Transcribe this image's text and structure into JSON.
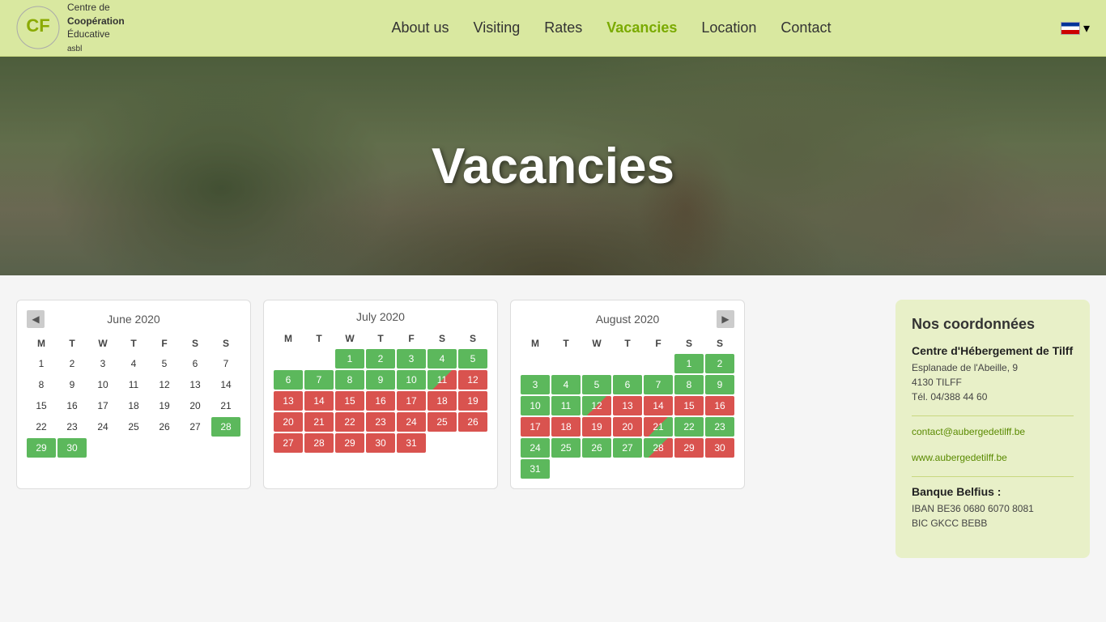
{
  "header": {
    "logo_line1": "Centre de",
    "logo_line2": "Coopération",
    "logo_line3": "Éducative",
    "logo_line4": "asbl",
    "nav": [
      {
        "label": "About us",
        "active": false
      },
      {
        "label": "Visiting",
        "active": false
      },
      {
        "label": "Rates",
        "active": false
      },
      {
        "label": "Vacancies",
        "active": true
      },
      {
        "label": "Location",
        "active": false
      },
      {
        "label": "Contact",
        "active": false
      }
    ]
  },
  "hero": {
    "title": "Vacancies"
  },
  "calendars": [
    {
      "month": "June 2020",
      "has_prev": true,
      "has_next": false,
      "days_of_week": [
        "M",
        "T",
        "W",
        "T",
        "F",
        "S",
        "S"
      ],
      "weeks": [
        [
          {
            "n": 1,
            "c": "white-bg"
          },
          {
            "n": 2,
            "c": "white-bg"
          },
          {
            "n": 3,
            "c": "white-bg"
          },
          {
            "n": 4,
            "c": "white-bg"
          },
          {
            "n": 5,
            "c": "white-bg"
          },
          {
            "n": 6,
            "c": "white-bg"
          },
          {
            "n": 7,
            "c": "white-bg"
          }
        ],
        [
          {
            "n": 8,
            "c": "white-bg"
          },
          {
            "n": 9,
            "c": "white-bg"
          },
          {
            "n": 10,
            "c": "white-bg"
          },
          {
            "n": 11,
            "c": "white-bg"
          },
          {
            "n": 12,
            "c": "white-bg"
          },
          {
            "n": 13,
            "c": "white-bg"
          },
          {
            "n": 14,
            "c": "white-bg"
          }
        ],
        [
          {
            "n": 15,
            "c": "white-bg"
          },
          {
            "n": 16,
            "c": "white-bg"
          },
          {
            "n": 17,
            "c": "white-bg"
          },
          {
            "n": 18,
            "c": "white-bg"
          },
          {
            "n": 19,
            "c": "white-bg"
          },
          {
            "n": 20,
            "c": "white-bg"
          },
          {
            "n": 21,
            "c": "white-bg"
          }
        ],
        [
          {
            "n": 22,
            "c": "white-bg"
          },
          {
            "n": 23,
            "c": "white-bg"
          },
          {
            "n": 24,
            "c": "white-bg"
          },
          {
            "n": 25,
            "c": "white-bg"
          },
          {
            "n": 26,
            "c": "white-bg"
          },
          {
            "n": 27,
            "c": "white-bg"
          },
          {
            "n": 28,
            "c": "green"
          }
        ],
        [
          {
            "n": 29,
            "c": "green"
          },
          {
            "n": 30,
            "c": "green"
          },
          {
            "n": 0,
            "c": "empty"
          },
          {
            "n": 0,
            "c": "empty"
          },
          {
            "n": 0,
            "c": "empty"
          },
          {
            "n": 0,
            "c": "empty"
          },
          {
            "n": 0,
            "c": "empty"
          }
        ]
      ]
    },
    {
      "month": "July 2020",
      "has_prev": false,
      "has_next": false,
      "days_of_week": [
        "M",
        "T",
        "W",
        "T",
        "F",
        "S",
        "S"
      ],
      "weeks": [
        [
          {
            "n": 0,
            "c": "empty"
          },
          {
            "n": 0,
            "c": "empty"
          },
          {
            "n": 1,
            "c": "green"
          },
          {
            "n": 2,
            "c": "green"
          },
          {
            "n": 3,
            "c": "green"
          },
          {
            "n": 4,
            "c": "green"
          },
          {
            "n": 5,
            "c": "green"
          }
        ],
        [
          {
            "n": 6,
            "c": "green"
          },
          {
            "n": 7,
            "c": "green"
          },
          {
            "n": 8,
            "c": "green"
          },
          {
            "n": 9,
            "c": "green"
          },
          {
            "n": 10,
            "c": "green"
          },
          {
            "n": 11,
            "c": "half-green-red"
          },
          {
            "n": 12,
            "c": "red"
          }
        ],
        [
          {
            "n": 13,
            "c": "red"
          },
          {
            "n": 14,
            "c": "red"
          },
          {
            "n": 15,
            "c": "red"
          },
          {
            "n": 16,
            "c": "red"
          },
          {
            "n": 17,
            "c": "red"
          },
          {
            "n": 18,
            "c": "red"
          },
          {
            "n": 19,
            "c": "red"
          }
        ],
        [
          {
            "n": 20,
            "c": "red"
          },
          {
            "n": 21,
            "c": "red"
          },
          {
            "n": 22,
            "c": "red"
          },
          {
            "n": 23,
            "c": "red"
          },
          {
            "n": 24,
            "c": "red"
          },
          {
            "n": 25,
            "c": "red"
          },
          {
            "n": 26,
            "c": "red"
          }
        ],
        [
          {
            "n": 27,
            "c": "red"
          },
          {
            "n": 28,
            "c": "red"
          },
          {
            "n": 29,
            "c": "red"
          },
          {
            "n": 30,
            "c": "red"
          },
          {
            "n": 31,
            "c": "red"
          },
          {
            "n": 0,
            "c": "empty"
          },
          {
            "n": 0,
            "c": "empty"
          }
        ]
      ]
    },
    {
      "month": "August 2020",
      "has_prev": false,
      "has_next": true,
      "days_of_week": [
        "M",
        "T",
        "W",
        "T",
        "F",
        "S",
        "S"
      ],
      "weeks": [
        [
          {
            "n": 0,
            "c": "empty"
          },
          {
            "n": 0,
            "c": "empty"
          },
          {
            "n": 0,
            "c": "empty"
          },
          {
            "n": 0,
            "c": "empty"
          },
          {
            "n": 0,
            "c": "empty"
          },
          {
            "n": 1,
            "c": "green"
          },
          {
            "n": 2,
            "c": "green"
          }
        ],
        [
          {
            "n": 3,
            "c": "green"
          },
          {
            "n": 4,
            "c": "green"
          },
          {
            "n": 5,
            "c": "green"
          },
          {
            "n": 6,
            "c": "green"
          },
          {
            "n": 7,
            "c": "green"
          },
          {
            "n": 8,
            "c": "green"
          },
          {
            "n": 9,
            "c": "green"
          }
        ],
        [
          {
            "n": 10,
            "c": "green"
          },
          {
            "n": 11,
            "c": "green"
          },
          {
            "n": 12,
            "c": "half-green-red"
          },
          {
            "n": 13,
            "c": "red"
          },
          {
            "n": 14,
            "c": "red"
          },
          {
            "n": 15,
            "c": "red"
          },
          {
            "n": 16,
            "c": "red"
          }
        ],
        [
          {
            "n": 17,
            "c": "red"
          },
          {
            "n": 18,
            "c": "red"
          },
          {
            "n": 19,
            "c": "red"
          },
          {
            "n": 20,
            "c": "red"
          },
          {
            "n": 21,
            "c": "half-red-green"
          },
          {
            "n": 22,
            "c": "green"
          },
          {
            "n": 23,
            "c": "green"
          }
        ],
        [
          {
            "n": 24,
            "c": "green"
          },
          {
            "n": 25,
            "c": "green"
          },
          {
            "n": 26,
            "c": "green"
          },
          {
            "n": 27,
            "c": "green"
          },
          {
            "n": 28,
            "c": "half-green-red"
          },
          {
            "n": 29,
            "c": "red"
          },
          {
            "n": 30,
            "c": "red"
          }
        ],
        [
          {
            "n": 31,
            "c": "green"
          },
          {
            "n": 0,
            "c": "empty"
          },
          {
            "n": 0,
            "c": "empty"
          },
          {
            "n": 0,
            "c": "empty"
          },
          {
            "n": 0,
            "c": "empty"
          },
          {
            "n": 0,
            "c": "empty"
          },
          {
            "n": 0,
            "c": "empty"
          }
        ]
      ]
    }
  ],
  "sidebar": {
    "title": "Nos coordonnées",
    "sections": [
      {
        "heading": "Centre d'Hébergement de Tilff",
        "lines": [
          "Esplanade de l'Abeille, 9",
          "4130 TILFF",
          "Tél. 04/388 44 60"
        ]
      },
      {
        "type": "link",
        "text": "contact@aubergedetilff.be"
      },
      {
        "type": "link",
        "text": "www.aubergedetilff.be"
      },
      {
        "heading": "Banque Belfius :",
        "lines": [
          "IBAN BE36 0680 6070 8081",
          "BIC GKCC BEBB"
        ]
      }
    ]
  }
}
